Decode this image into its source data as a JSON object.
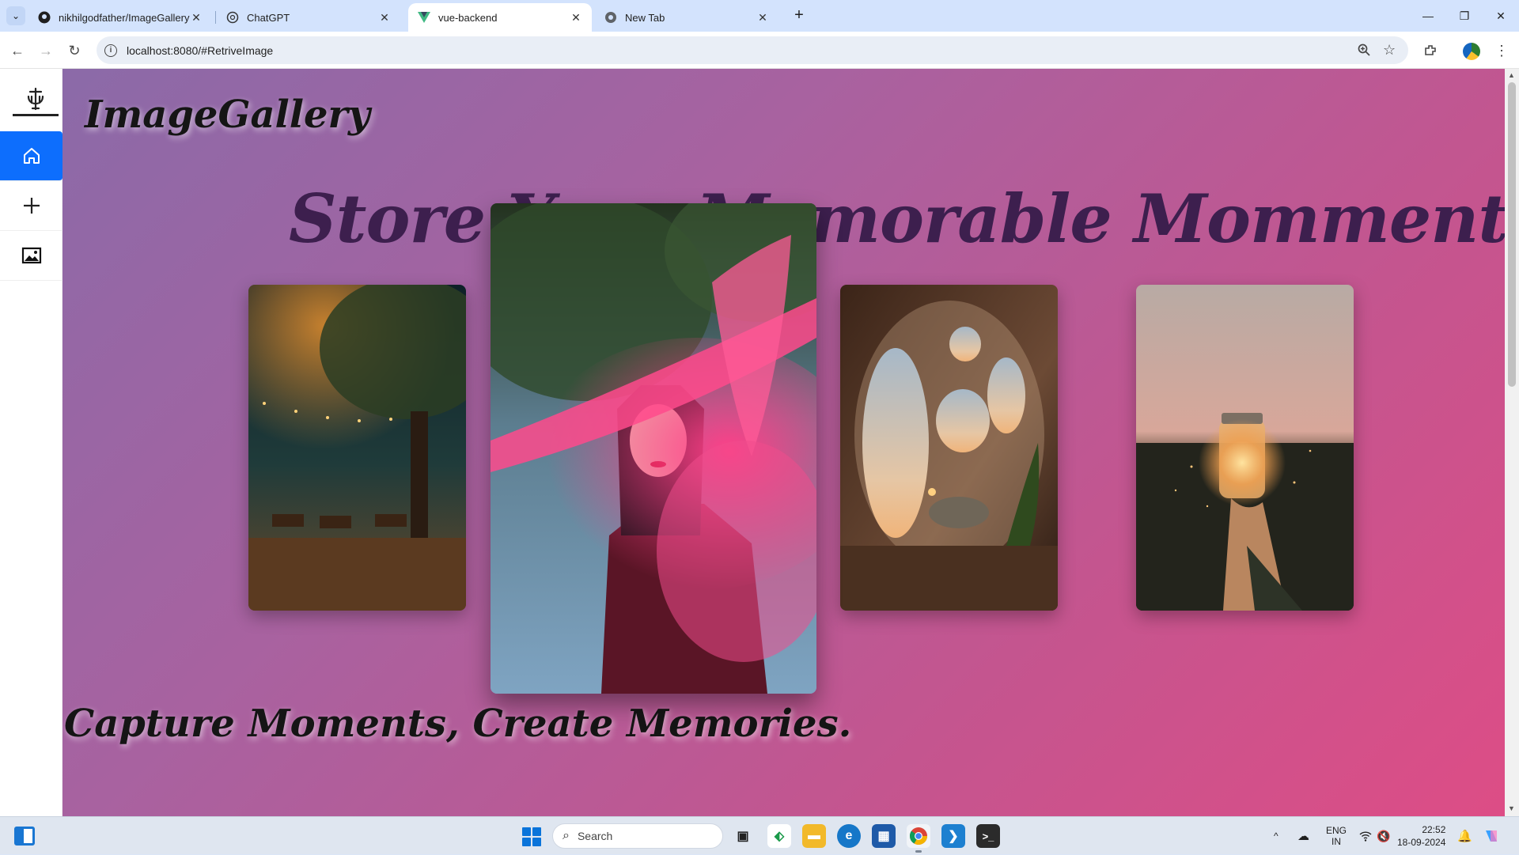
{
  "browser": {
    "tabs": [
      {
        "title": "nikhilgodfather/ImageGallery",
        "icon": "github-icon",
        "active": false
      },
      {
        "title": "ChatGPT",
        "icon": "chatgpt-icon",
        "active": false
      },
      {
        "title": "vue-backend",
        "icon": "vue-icon",
        "active": true
      },
      {
        "title": "New Tab",
        "icon": "chrome-icon",
        "active": false
      }
    ],
    "url": "localhost:8080/#RetriveImage",
    "window_controls": {
      "minimize": "—",
      "restore": "❐",
      "close": "✕"
    }
  },
  "sidebar": {
    "items": [
      {
        "name": "home",
        "icon": "home-icon",
        "active": true
      },
      {
        "name": "add",
        "icon": "plus-icon",
        "active": false
      },
      {
        "name": "gallery",
        "icon": "image-icon",
        "active": false
      }
    ]
  },
  "main": {
    "brand": "ImageGallery",
    "headline": "Store Your Memorable Momments",
    "tagline": "Capture Moments, Create Memories.",
    "gallery": [
      {
        "name": "night-park-photo",
        "description_icon": "photo"
      },
      {
        "name": "pink-smoke-portrait-photo",
        "description_icon": "photo",
        "featured": true
      },
      {
        "name": "round-window-room-photo",
        "description_icon": "photo"
      },
      {
        "name": "glowing-jar-photo",
        "description_icon": "photo"
      }
    ],
    "colors": {
      "gradient_start": "#8b6aa8",
      "gradient_end": "#dd4d86",
      "headline": "#3d1f4e",
      "sidebar_active": "#0d6efd"
    }
  },
  "taskbar": {
    "search_placeholder": "Search",
    "language": "ENG",
    "region": "IN",
    "time": "22:52",
    "date": "18-09-2024"
  }
}
